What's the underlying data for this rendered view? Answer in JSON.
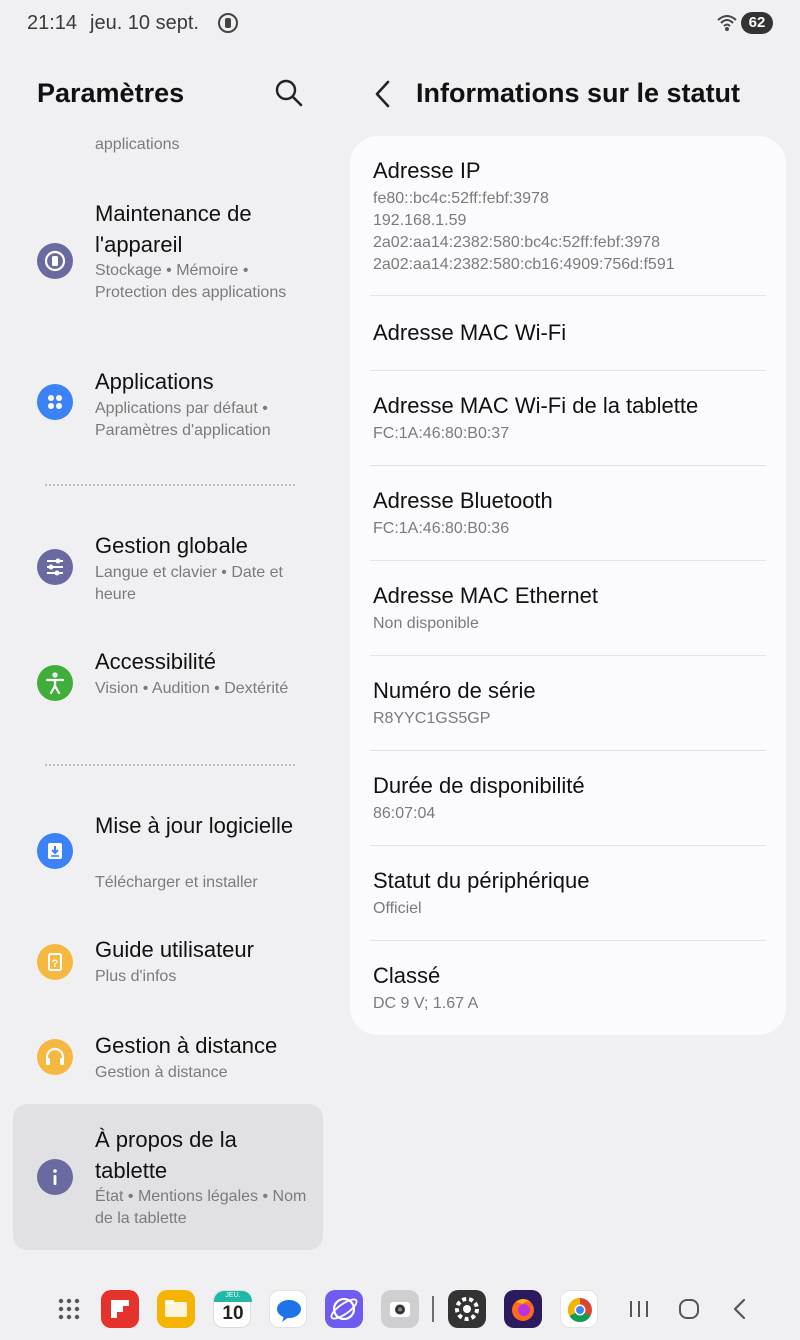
{
  "status_bar": {
    "time": "21:14",
    "date": "jeu. 10 sept.",
    "battery": "62"
  },
  "left_panel": {
    "title": "Paramètres",
    "cut_item_sub": "applications",
    "items": [
      {
        "title": "Maintenance de l'appareil",
        "subtitle": "Stockage • Mémoire • Protection des applications",
        "icon": "device-maintenance-icon",
        "color": "#6a6aa0"
      },
      {
        "title": "Applications",
        "subtitle": "Applications par défaut • Paramètres d'application",
        "icon": "apps-icon",
        "color": "#3b82f6"
      },
      {
        "title": "Gestion globale",
        "subtitle": "Langue et clavier • Date et heure",
        "icon": "sliders-icon",
        "color": "#6a6aa0"
      },
      {
        "title": "Accessibilité",
        "subtitle": "Vision • Audition • Dextérité",
        "icon": "accessibility-icon",
        "color": "#3fae3a"
      },
      {
        "title": "Mise à jour logicielle",
        "subtitle": "Télécharger et installer",
        "icon": "software-update-icon",
        "color": "#3b82f6"
      },
      {
        "title": "Guide utilisateur",
        "subtitle": "Plus d'infos",
        "icon": "user-guide-icon",
        "color": "#f5b942"
      },
      {
        "title": "Gestion à distance",
        "subtitle": "Gestion à distance",
        "icon": "headset-icon",
        "color": "#f5b942"
      },
      {
        "title": "À propos de la tablette",
        "subtitle": "État • Mentions légales • Nom de la tablette",
        "icon": "info-icon",
        "color": "#6a6aa0"
      }
    ]
  },
  "right_panel": {
    "title": "Informations sur le statut",
    "rows": [
      {
        "label": "Adresse IP",
        "value": "fe80::bc4c:52ff:febf:3978\n192.168.1.59\n2a02:aa14:2382:580:bc4c:52ff:febf:3978\n2a02:aa14:2382:580:cb16:4909:756d:f591"
      },
      {
        "label": "Adresse MAC Wi-Fi",
        "value": ""
      },
      {
        "label": "Adresse MAC Wi-Fi de la tablette",
        "value": "FC:1A:46:80:B0:37"
      },
      {
        "label": "Adresse Bluetooth",
        "value": "FC:1A:46:80:B0:36"
      },
      {
        "label": "Adresse MAC Ethernet",
        "value": "Non disponible"
      },
      {
        "label": "Numéro de série",
        "value": "R8YYC1GS5GP"
      },
      {
        "label": "Durée de disponibilité",
        "value": "86:07:04"
      },
      {
        "label": "Statut du périphérique",
        "value": "Officiel"
      },
      {
        "label": "Classé",
        "value": "DC 9 V; 1.67 A"
      }
    ]
  },
  "dock": {
    "calendar_day_label": "JEU.",
    "calendar_day": "10",
    "apps": [
      "app-drawer-icon",
      "flipboard-icon",
      "folder-icon",
      "calendar-icon",
      "messages-icon",
      "internet-icon",
      "camera-icon",
      "settings-icon",
      "firefox-icon",
      "chrome-icon"
    ]
  }
}
